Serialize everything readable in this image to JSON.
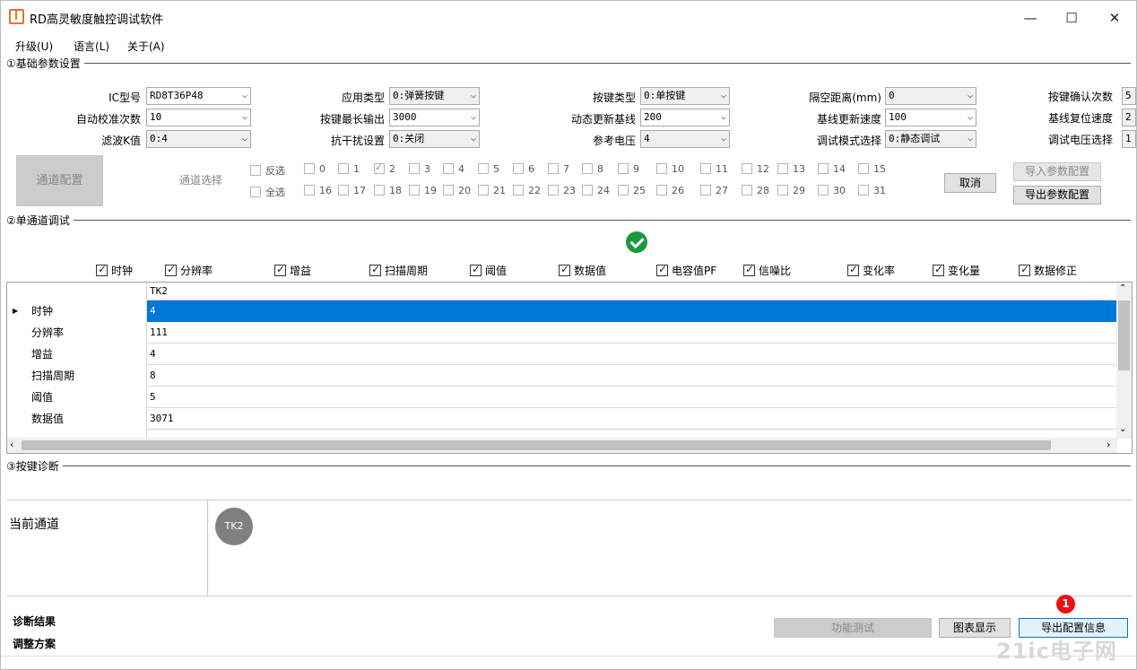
{
  "window": {
    "title": "RD高灵敏度触控调试软件",
    "minimize": "—",
    "maximize": "☐",
    "close": "✕"
  },
  "menu": [
    "升级(U)",
    "语言(L)",
    "关于(A)"
  ],
  "section1": {
    "title": "①基础参数设置",
    "fields": [
      {
        "label": "IC型号",
        "value": "RD8T36P48"
      },
      {
        "label": "自动校准次数",
        "value": "10"
      },
      {
        "label": "滤波K值",
        "value": "0:4"
      },
      {
        "label": "应用类型",
        "value": "0:弹簧按键"
      },
      {
        "label": "按键最长输出",
        "value": "3000"
      },
      {
        "label": "抗干扰设置",
        "value": "0:关闭"
      },
      {
        "label": "按键类型",
        "value": "0:单按键"
      },
      {
        "label": "动态更新基线",
        "value": "200"
      },
      {
        "label": "参考电压",
        "value": "4"
      },
      {
        "label": "隔空距离(mm)",
        "value": "0"
      },
      {
        "label": "基线更新速度",
        "value": "100"
      },
      {
        "label": "调试模式选择",
        "value": "0:静态调试"
      },
      {
        "label": "按键确认次数",
        "value": "5"
      },
      {
        "label": "基线复位速度",
        "value": "2"
      },
      {
        "label": "调试电压选择",
        "value": "1"
      }
    ],
    "channel_config_button": "通道配置",
    "channel_select_label": "通道选择",
    "invert_label": "反选",
    "select_all_label": "全选",
    "channels_row1": [
      "0",
      "1",
      "2",
      "3",
      "4",
      "5",
      "6",
      "7",
      "8",
      "9",
      "10",
      "11",
      "12",
      "13",
      "14",
      "15"
    ],
    "channels_row2": [
      "16",
      "17",
      "18",
      "19",
      "20",
      "21",
      "22",
      "23",
      "24",
      "25",
      "26",
      "27",
      "28",
      "29",
      "30",
      "31"
    ],
    "checked_channel": "2",
    "cancel_button": "取消",
    "import_button": "导入参数配置",
    "export_button": "导出参数配置"
  },
  "section2": {
    "title": "②单通道调试",
    "columns": [
      "时钟",
      "分辨率",
      "增益",
      "扫描周期",
      "阈值",
      "数据值",
      "电容值PF",
      "信噪比",
      "变化率",
      "变化量",
      "数据修正"
    ],
    "grid_header": "TK2",
    "rows": [
      {
        "label": "时钟",
        "value": "4"
      },
      {
        "label": "分辨率",
        "value": "111"
      },
      {
        "label": "增益",
        "value": "4"
      },
      {
        "label": "扫描周期",
        "value": "8"
      },
      {
        "label": "阈值",
        "value": "5"
      },
      {
        "label": "数据值",
        "value": "3071"
      }
    ]
  },
  "section3": {
    "title": "③按键诊断",
    "current_channel_label": "当前通道",
    "channel_badge": "TK2",
    "diag_result_label": "诊断结果",
    "adjust_label": "调整方案",
    "func_test_button": "功能测试",
    "chart_button": "图表显示",
    "export_info_button": "导出配置信息",
    "badge_number": "1"
  },
  "watermark": "21ic电子网",
  "colors": {
    "selection": "#0078d7",
    "check": "#1a9a3a",
    "badge": "#ee1111"
  }
}
